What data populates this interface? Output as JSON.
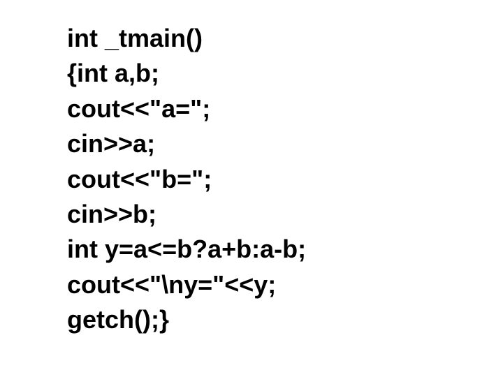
{
  "code": {
    "line1": "int _tmain()",
    "line2": "{int a,b;",
    "line3": "cout<<\"a=\";",
    "line4": "cin>>a;",
    "line5": "cout<<\"b=\";",
    "line6": "cin>>b;",
    "line7": "int y=a<=b?a+b:a-b;",
    "line8": "cout<<\"\\ny=\"<<y;",
    "line9": "getch();}"
  }
}
